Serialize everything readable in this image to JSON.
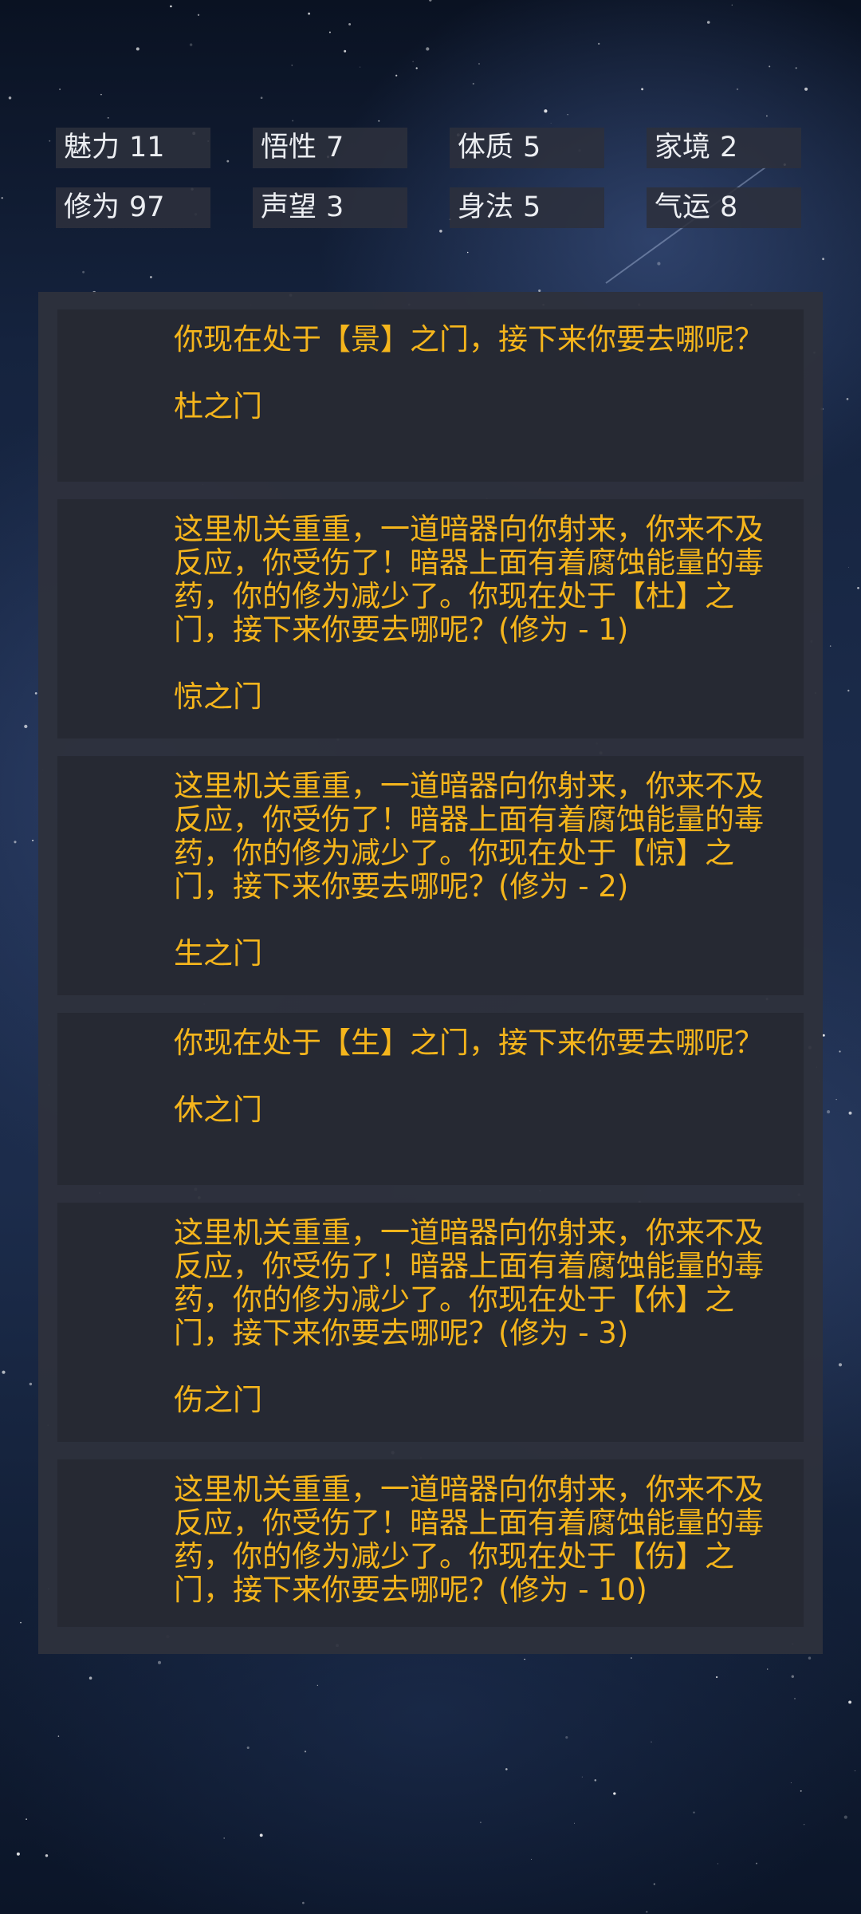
{
  "colors": {
    "accent_text": "#f5b51c",
    "stat_text": "#eceef2",
    "panel_bg": "#2e313c",
    "card_bg": "#262933"
  },
  "stats": [
    {
      "label": "魅力",
      "value": "11"
    },
    {
      "label": "悟性",
      "value": "7"
    },
    {
      "label": "体质",
      "value": "5"
    },
    {
      "label": "家境",
      "value": "2"
    },
    {
      "label": "修为",
      "value": "97"
    },
    {
      "label": "声望",
      "value": "3"
    },
    {
      "label": "身法",
      "value": "5"
    },
    {
      "label": "气运",
      "value": "8"
    }
  ],
  "log": [
    {
      "message": "你现在处于【景】之门，接下来你要去哪呢？",
      "choice": "杜之门"
    },
    {
      "message": "这里机关重重，一道暗器向你射来，你来不及反应，你受伤了！暗器上面有着腐蚀能量的毒药，你的修为减少了。你现在处于【杜】之门，接下来你要去哪呢？(修为 - 1)",
      "choice": "惊之门"
    },
    {
      "message": "这里机关重重，一道暗器向你射来，你来不及反应，你受伤了！暗器上面有着腐蚀能量的毒药，你的修为减少了。你现在处于【惊】之门，接下来你要去哪呢？(修为 - 2)",
      "choice": "生之门"
    },
    {
      "message": "你现在处于【生】之门，接下来你要去哪呢？",
      "choice": "休之门"
    },
    {
      "message": "这里机关重重，一道暗器向你射来，你来不及反应，你受伤了！暗器上面有着腐蚀能量的毒药，你的修为减少了。你现在处于【休】之门，接下来你要去哪呢？(修为 - 3)",
      "choice": "伤之门"
    },
    {
      "message": "这里机关重重，一道暗器向你射来，你来不及反应，你受伤了！暗器上面有着腐蚀能量的毒药，你的修为减少了。你现在处于【伤】之门，接下来你要去哪呢？(修为 - 10)"
    }
  ]
}
